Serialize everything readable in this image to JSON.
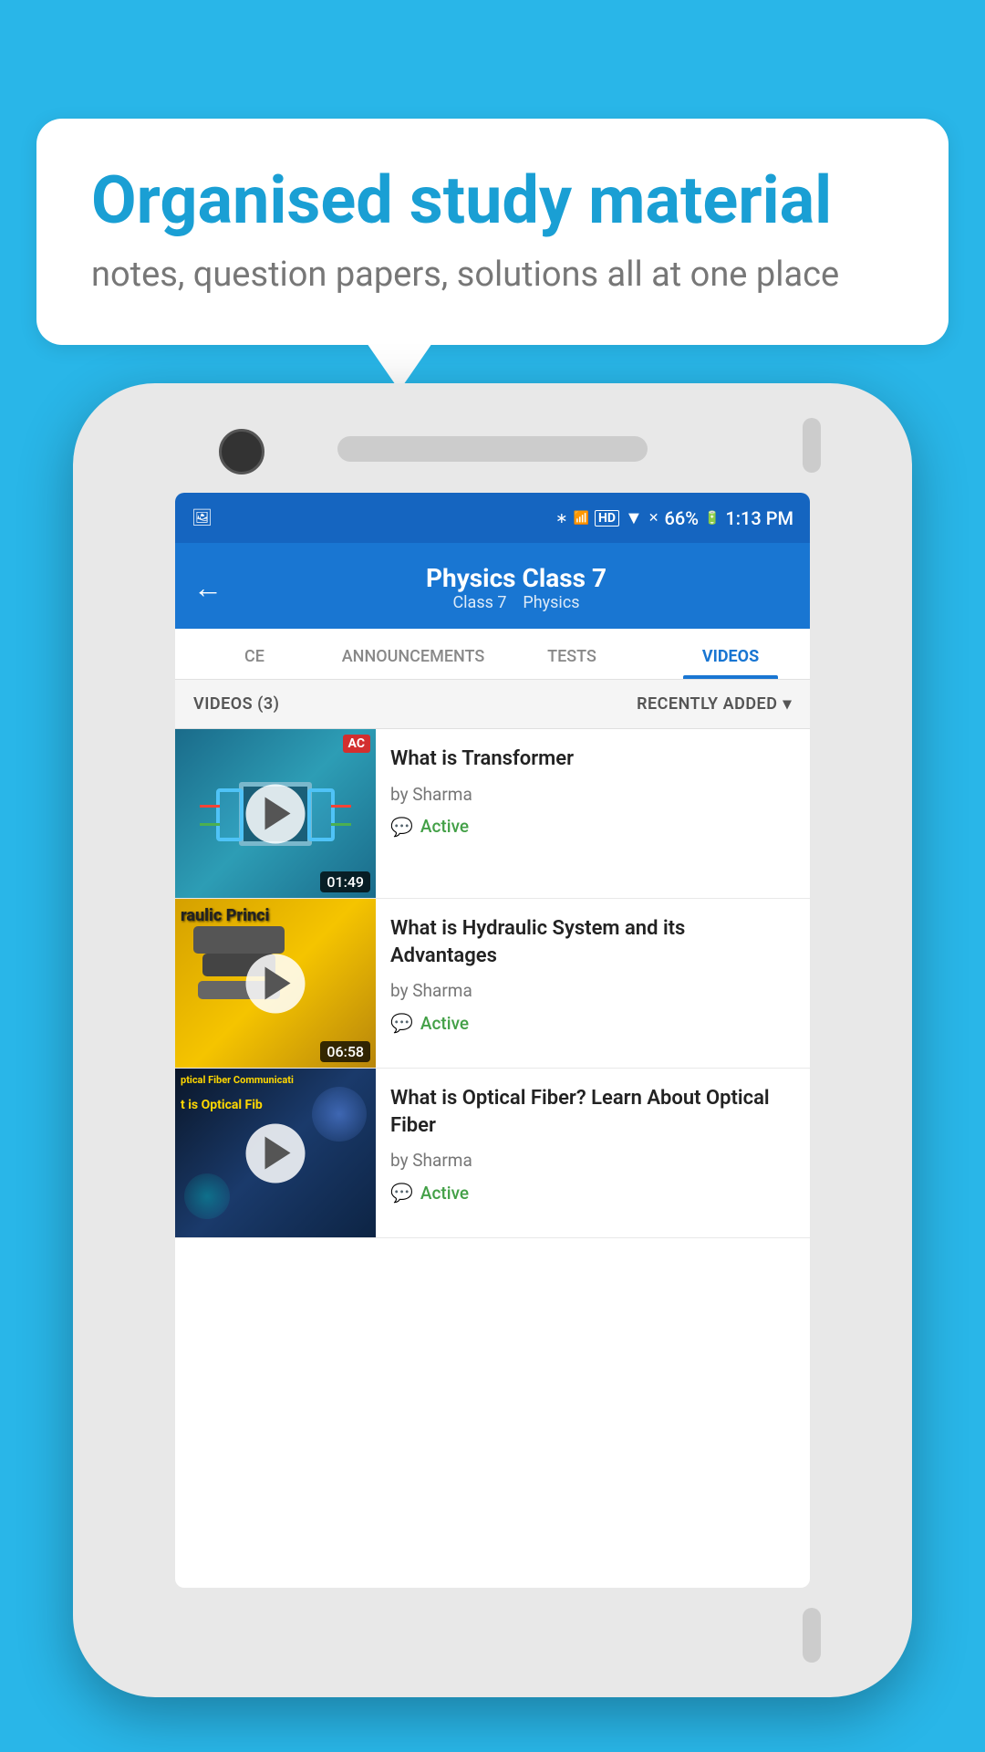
{
  "background_color": "#29b6e8",
  "bubble": {
    "title": "Organised study material",
    "subtitle": "notes, question papers, solutions all at one place"
  },
  "status_bar": {
    "battery": "66%",
    "time": "1:13 PM",
    "network": "HD"
  },
  "app_bar": {
    "title": "Physics Class 7",
    "subtitle_class": "Class 7",
    "subtitle_subject": "Physics",
    "back_label": "←"
  },
  "tabs": [
    {
      "id": "ce",
      "label": "CE",
      "active": false
    },
    {
      "id": "announcements",
      "label": "ANNOUNCEMENTS",
      "active": false
    },
    {
      "id": "tests",
      "label": "TESTS",
      "active": false
    },
    {
      "id": "videos",
      "label": "VIDEOS",
      "active": true
    }
  ],
  "filter_bar": {
    "count_label": "VIDEOS (3)",
    "sort_label": "RECENTLY ADDED",
    "sort_icon": "▾"
  },
  "videos": [
    {
      "id": "v1",
      "title": "What is  Transformer",
      "author": "by Sharma",
      "status": "Active",
      "duration": "01:49",
      "badge": "AC",
      "thumb_type": "transformer"
    },
    {
      "id": "v2",
      "title": "What is Hydraulic System and its Advantages",
      "author": "by Sharma",
      "status": "Active",
      "duration": "06:58",
      "thumb_type": "hydraulic",
      "thumb_text": "raulic Princi"
    },
    {
      "id": "v3",
      "title": "What is Optical Fiber? Learn About Optical Fiber",
      "author": "by Sharma",
      "status": "Active",
      "duration": "",
      "thumb_type": "optical",
      "thumb_text_line1": "ptical Fiber Communicati",
      "thumb_text_line2": "t is Optical Fib"
    }
  ]
}
